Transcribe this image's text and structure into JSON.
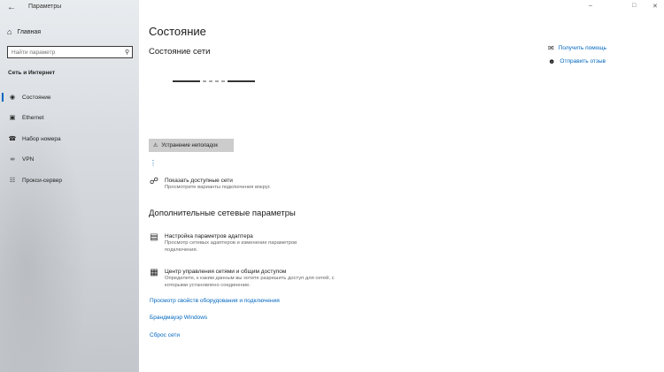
{
  "window": {
    "app_title": "Параметры",
    "controls": [
      "–",
      "□",
      "✕"
    ]
  },
  "sidebar": {
    "home_label": "Главная",
    "search_placeholder": "Найти параметр",
    "section_title": "Сеть и Интернет",
    "items": [
      {
        "label": "Состояние",
        "icon": "status-icon",
        "active": true
      },
      {
        "label": "Ethernet",
        "icon": "ethernet-icon",
        "active": false
      },
      {
        "label": "Набор номера",
        "icon": "dialup-icon",
        "active": false
      },
      {
        "label": "VPN",
        "icon": "vpn-icon",
        "active": false
      },
      {
        "label": "Прокси-сервер",
        "icon": "globe-icon",
        "active": false
      }
    ]
  },
  "main": {
    "page_title": "Состояние",
    "subtitle": "Состояние сети",
    "troubleshoot_label": "Устранение неполадок",
    "show_networks": {
      "title": "Показать доступные сети",
      "desc": "Просмотрите варианты подключения вокруг."
    },
    "section_title": "Дополнительные сетевые параметры",
    "adapter_settings": {
      "title": "Настройка параметров адаптера",
      "desc": "Просмотр сетевых адаптеров и изменение параметров подключения."
    },
    "sharing_center": {
      "title": "Центр управления сетями и общим доступом",
      "desc": "Определите, к каким данным вы хотите разрешить доступ для сетей, с которыми установлено соединение."
    },
    "links": [
      "Просмотр свойств оборудования и подключения",
      "Брандмауэр Windows",
      "Сброс сети"
    ]
  },
  "help": {
    "get_help": "Получить помощь",
    "feedback": "Отправить отзыв"
  },
  "colors": {
    "accent": "#0067c0",
    "button_bg": "#cccccc"
  }
}
